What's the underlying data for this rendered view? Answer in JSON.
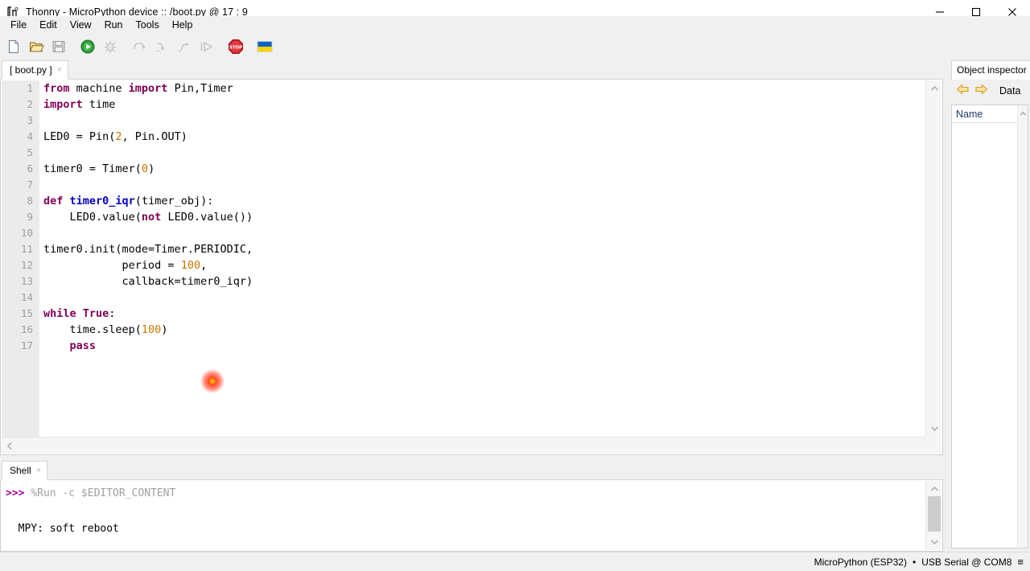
{
  "window": {
    "title": "Thonny  -  MicroPython device :: /boot.py  @  17 : 9",
    "app_icon": "thonny-icon",
    "minimize": "—",
    "maximize": "□",
    "close": "✕"
  },
  "menu": {
    "items": [
      {
        "label": "File"
      },
      {
        "label": "Edit"
      },
      {
        "label": "View"
      },
      {
        "label": "Run"
      },
      {
        "label": "Tools"
      },
      {
        "label": "Help"
      }
    ]
  },
  "toolbar": {
    "buttons": [
      {
        "name": "new-file-icon",
        "title": "New"
      },
      {
        "name": "open-file-icon",
        "title": "Open"
      },
      {
        "name": "save-file-icon",
        "title": "Save"
      },
      {
        "name": "run-icon",
        "title": "Run current script"
      },
      {
        "name": "debug-icon",
        "title": "Debug current script"
      },
      {
        "name": "step-over-icon",
        "title": "Step over"
      },
      {
        "name": "step-into-icon",
        "title": "Step into"
      },
      {
        "name": "step-out-icon",
        "title": "Step out"
      },
      {
        "name": "resume-icon",
        "title": "Resume"
      },
      {
        "name": "stop-icon",
        "title": "Stop / Restart backend"
      },
      {
        "name": "ukraine-flag-icon",
        "title": "Support Ukraine"
      }
    ]
  },
  "editor": {
    "tab": {
      "label": "[ boot.py ]",
      "close": "×"
    },
    "lines": [
      {
        "n": "1",
        "tokens": [
          {
            "t": "from",
            "c": "kw"
          },
          {
            "t": " machine ",
            "c": ""
          },
          {
            "t": "import",
            "c": "kw"
          },
          {
            "t": " Pin,Timer",
            "c": ""
          }
        ]
      },
      {
        "n": "2",
        "tokens": [
          {
            "t": "import",
            "c": "kw"
          },
          {
            "t": " time",
            "c": ""
          }
        ]
      },
      {
        "n": "3",
        "tokens": []
      },
      {
        "n": "4",
        "tokens": [
          {
            "t": "LED0 = Pin(",
            "c": ""
          },
          {
            "t": "2",
            "c": "num"
          },
          {
            "t": ", Pin.OUT)",
            "c": ""
          }
        ]
      },
      {
        "n": "5",
        "tokens": []
      },
      {
        "n": "6",
        "tokens": [
          {
            "t": "timer0 = Timer(",
            "c": ""
          },
          {
            "t": "0",
            "c": "num"
          },
          {
            "t": ")",
            "c": ""
          }
        ]
      },
      {
        "n": "7",
        "tokens": []
      },
      {
        "n": "8",
        "tokens": [
          {
            "t": "def",
            "c": "kw"
          },
          {
            "t": " ",
            "c": ""
          },
          {
            "t": "timer0_iqr",
            "c": "fn"
          },
          {
            "t": "(timer_obj):",
            "c": ""
          }
        ]
      },
      {
        "n": "9",
        "tokens": [
          {
            "t": "    LED0.value(",
            "c": ""
          },
          {
            "t": "not",
            "c": "kw"
          },
          {
            "t": " LED0.value())",
            "c": ""
          }
        ]
      },
      {
        "n": "10",
        "tokens": []
      },
      {
        "n": "11",
        "tokens": [
          {
            "t": "timer0.init(mode=Timer.PERIODIC,",
            "c": ""
          }
        ]
      },
      {
        "n": "12",
        "tokens": [
          {
            "t": "            period = ",
            "c": ""
          },
          {
            "t": "100",
            "c": "num"
          },
          {
            "t": ",",
            "c": ""
          }
        ]
      },
      {
        "n": "13",
        "tokens": [
          {
            "t": "            callback=timer0_iqr)",
            "c": ""
          }
        ]
      },
      {
        "n": "14",
        "tokens": []
      },
      {
        "n": "15",
        "tokens": [
          {
            "t": "while",
            "c": "kw"
          },
          {
            "t": " ",
            "c": ""
          },
          {
            "t": "True",
            "c": "kw"
          },
          {
            "t": ":",
            "c": ""
          }
        ]
      },
      {
        "n": "16",
        "tokens": [
          {
            "t": "    time.sleep(",
            "c": ""
          },
          {
            "t": "100",
            "c": "num"
          },
          {
            "t": ")",
            "c": ""
          }
        ]
      },
      {
        "n": "17",
        "tokens": [
          {
            "t": "    ",
            "c": ""
          },
          {
            "t": "pass",
            "c": "kw"
          }
        ]
      }
    ]
  },
  "shell": {
    "tab": {
      "label": "Shell",
      "close": "×"
    },
    "lines": [
      {
        "prompt": ">>> ",
        "cmd": "%Run -c $EDITOR_CONTENT",
        "out": ""
      },
      {
        "prompt": "",
        "cmd": "",
        "out": ""
      },
      {
        "prompt": "",
        "cmd": "",
        "out": "MPY: soft reboot"
      }
    ]
  },
  "inspector": {
    "tab_label": "Object inspector",
    "back_icon": "arrow-left-icon",
    "forward_icon": "arrow-right-icon",
    "data_label": "Data",
    "column_header": "Name"
  },
  "statusbar": {
    "interpreter": "MicroPython (ESP32)",
    "separator": "•",
    "connection": "USB Serial @ COM8",
    "menu_icon": "≡"
  },
  "colors": {
    "keyword": "#7f0055",
    "number": "#cc7700",
    "function": "#0000bf",
    "prompt": "#a000a0",
    "run_green": "#2a9c36",
    "stop_red": "#d42027",
    "flag_blue": "#0b63c5",
    "flag_yellow": "#fcd400"
  }
}
